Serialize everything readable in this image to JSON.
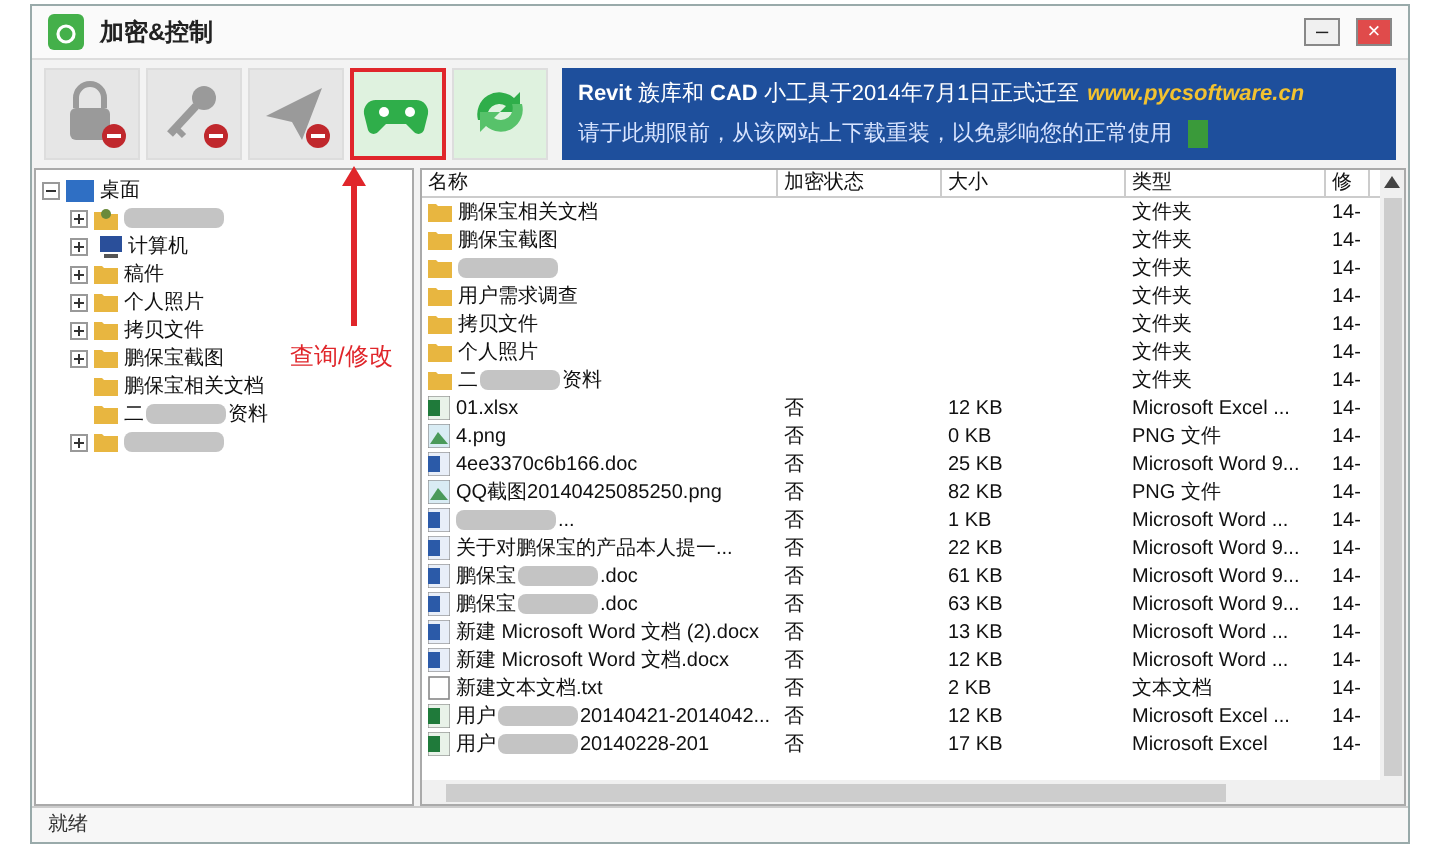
{
  "window": {
    "title": "加密&控制",
    "buttons": [
      {
        "kind": "minimize",
        "label": "–"
      },
      {
        "kind": "close",
        "label": "×"
      }
    ]
  },
  "toolbar": [
    {
      "kind": "lock",
      "disabled": true,
      "annotated": false
    },
    {
      "kind": "key",
      "disabled": true,
      "annotated": false
    },
    {
      "kind": "send",
      "disabled": true,
      "annotated": false
    },
    {
      "kind": "gamepad",
      "disabled": false,
      "annotated": true
    },
    {
      "kind": "refresh",
      "disabled": false,
      "annotated": false
    }
  ],
  "annotation": {
    "label": "查询/修改"
  },
  "banner": {
    "line1": "**Revit** 族库和 **CAD** 小工具于2014年7月1日正式迁至",
    "url": "www.pycsoftware.cn",
    "line2": "请于此期限前，从该网站上下载重装，以免影响您的正常使用"
  },
  "tree": [
    {
      "label": "桌面",
      "kind": "desktop",
      "expanded": true,
      "children": [
        {
          "redacted": true,
          "kind": "user",
          "expandable": true
        },
        {
          "before": "计算机",
          "redacted": false,
          "kind": "computer",
          "expandable": true
        },
        {
          "before": "稿件",
          "redacted": false,
          "kind": "folder",
          "expandable": true
        },
        {
          "before": "个人照片",
          "redacted": false,
          "kind": "folder",
          "expandable": true
        },
        {
          "before": "拷贝文件",
          "redacted": false,
          "kind": "folder",
          "expandable": true
        },
        {
          "before": "鹏保宝截图",
          "redacted": false,
          "kind": "folder",
          "expandable": true
        },
        {
          "before": "鹏保宝相关文档",
          "redacted": false,
          "kind": "folder",
          "expandable": false
        },
        {
          "before": "二",
          "after": "资料",
          "redacted": true,
          "kind": "folder",
          "expandable": false
        },
        {
          "redacted": true,
          "kind": "folder",
          "expandable": true
        }
      ]
    }
  ],
  "table": {
    "columns": [
      "名称",
      "加密状态",
      "大小",
      "类型",
      "修"
    ],
    "rows": [
      {
        "kind": "folder",
        "before": "鹏保宝相关文档",
        "redacted": false,
        "type": "文件夹",
        "modified": "14-"
      },
      {
        "kind": "folder",
        "before": "鹏保宝截图",
        "redacted": false,
        "type": "文件夹",
        "modified": "14-"
      },
      {
        "kind": "folder",
        "redacted": true,
        "type": "文件夹",
        "modified": "14-"
      },
      {
        "kind": "folder",
        "before": "用户需求调查",
        "redacted": false,
        "type": "文件夹",
        "modified": "14-"
      },
      {
        "kind": "folder",
        "before": "拷贝文件",
        "redacted": false,
        "type": "文件夹",
        "modified": "14-"
      },
      {
        "kind": "folder",
        "before": "个人照片",
        "redacted": false,
        "type": "文件夹",
        "modified": "14-"
      },
      {
        "kind": "folder",
        "before": "二",
        "after": "资料",
        "redacted": true,
        "type": "文件夹",
        "modified": "14-"
      },
      {
        "kind": "excel",
        "before": "01.xlsx",
        "redacted": false,
        "encrypted": "否",
        "size": "12 KB",
        "type": "Microsoft Excel ...",
        "modified": "14-"
      },
      {
        "kind": "image",
        "before": "4.png",
        "redacted": false,
        "encrypted": "否",
        "size": "0 KB",
        "type": "PNG 文件",
        "modified": "14-"
      },
      {
        "kind": "word",
        "before": "4ee3370c6b166.doc",
        "redacted": false,
        "encrypted": "否",
        "size": "25 KB",
        "type": "Microsoft Word 9...",
        "modified": "14-"
      },
      {
        "kind": "image",
        "before": "QQ截图20140425085250.png",
        "redacted": false,
        "encrypted": "否",
        "size": "82 KB",
        "type": "PNG 文件",
        "modified": "14-"
      },
      {
        "kind": "word",
        "ellipsis": "...",
        "redacted": true,
        "encrypted": "否",
        "size": "1 KB",
        "type": "Microsoft Word ...",
        "modified": "14-"
      },
      {
        "kind": "word",
        "before": "关于对鹏保宝的产品本人提一...",
        "redacted": false,
        "encrypted": "否",
        "size": "22 KB",
        "type": "Microsoft Word 9...",
        "modified": "14-"
      },
      {
        "kind": "word",
        "before": "鹏保宝",
        "after": ".doc",
        "redacted": true,
        "encrypted": "否",
        "size": "61 KB",
        "type": "Microsoft Word 9...",
        "modified": "14-"
      },
      {
        "kind": "word",
        "before": "鹏保宝",
        "after": ".doc",
        "redacted": true,
        "encrypted": "否",
        "size": "63 KB",
        "type": "Microsoft Word 9...",
        "modified": "14-"
      },
      {
        "kind": "word",
        "before": "新建 Microsoft Word 文档 (2).docx",
        "redacted": false,
        "encrypted": "否",
        "size": "13 KB",
        "type": "Microsoft Word ...",
        "modified": "14-"
      },
      {
        "kind": "word",
        "before": "新建 Microsoft Word 文档.docx",
        "redacted": false,
        "encrypted": "否",
        "size": "12 KB",
        "type": "Microsoft Word ...",
        "modified": "14-"
      },
      {
        "kind": "text",
        "before": "新建文本文档.txt",
        "redacted": false,
        "encrypted": "否",
        "size": "2 KB",
        "type": "文本文档",
        "modified": "14-"
      },
      {
        "kind": "excel",
        "before": "用户",
        "after": "20140421-2014042...",
        "redacted": true,
        "encrypted": "否",
        "size": "12 KB",
        "type": "Microsoft Excel ...",
        "modified": "14-"
      },
      {
        "kind": "excel",
        "before": "用户",
        "after": "20140228-201",
        "redacted": true,
        "encrypted": "否",
        "size": "17 KB",
        "type": "Microsoft Excel",
        "modified": "14-"
      }
    ]
  },
  "status_bar": {
    "text": "就绪"
  }
}
